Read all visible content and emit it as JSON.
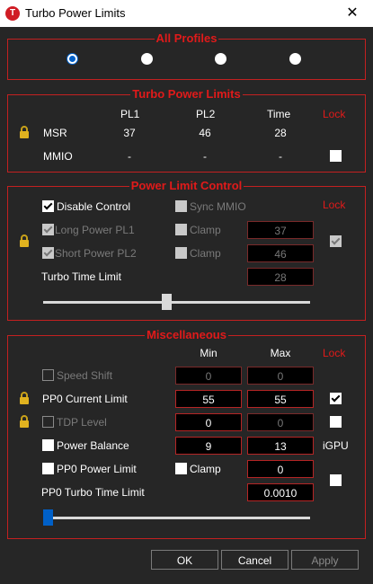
{
  "window": {
    "title": "Turbo Power Limits",
    "close_glyph": "✕",
    "icon_letter": "T"
  },
  "all_profiles": {
    "title": "All Profiles",
    "selected_index": 0,
    "count": 4
  },
  "turbo_power_limits": {
    "title": "Turbo Power Limits",
    "headers": {
      "pl1": "PL1",
      "pl2": "PL2",
      "time": "Time",
      "lock": "Lock"
    },
    "msr": {
      "label": "MSR",
      "pl1": "37",
      "pl2": "46",
      "time": "28"
    },
    "mmio": {
      "label": "MMIO",
      "pl1": "-",
      "pl2": "-",
      "time": "-",
      "lock_checked": false
    }
  },
  "power_limit_control": {
    "title": "Power Limit Control",
    "lock_label": "Lock",
    "disable_control": {
      "label": "Disable Control",
      "checked": true
    },
    "sync_mmio": {
      "label": "Sync MMIO",
      "checked": false
    },
    "long_power": {
      "label": "Long Power PL1",
      "checked": true,
      "clamp_label": "Clamp",
      "value": "37"
    },
    "short_power": {
      "label": "Short Power PL2",
      "checked": true,
      "clamp_label": "Clamp",
      "value": "46"
    },
    "lock_checked": true,
    "turbo_time": {
      "label": "Turbo Time Limit",
      "value": "28"
    },
    "slider_fraction": 0.46
  },
  "miscellaneous": {
    "title": "Miscellaneous",
    "headers": {
      "min": "Min",
      "max": "Max",
      "lock": "Lock"
    },
    "speed_shift": {
      "label": "Speed Shift",
      "min": "0",
      "max": "0"
    },
    "pp0_current_limit": {
      "label": "PP0 Current Limit",
      "min": "55",
      "max": "55",
      "lock_checked": true
    },
    "tdp_level": {
      "label": "TDP Level",
      "min": "0",
      "max": "0",
      "lock_checked": false
    },
    "power_balance": {
      "label": "Power Balance",
      "min": "9",
      "max": "13",
      "extra": "iGPU"
    },
    "pp0_power_limit": {
      "label": "PP0 Power Limit",
      "clamp_label": "Clamp",
      "value": "0",
      "lock_checked": false
    },
    "pp0_turbo_time_limit": {
      "label": "PP0 Turbo Time Limit",
      "value": "0.0010"
    },
    "slider_fraction": 0.0
  },
  "buttons": {
    "ok": "OK",
    "cancel": "Cancel",
    "apply": "Apply"
  },
  "colors": {
    "accent_red": "#e11a1a",
    "border_red": "#c32020",
    "bg": "#262626",
    "radio_blue": "#0060c8"
  }
}
